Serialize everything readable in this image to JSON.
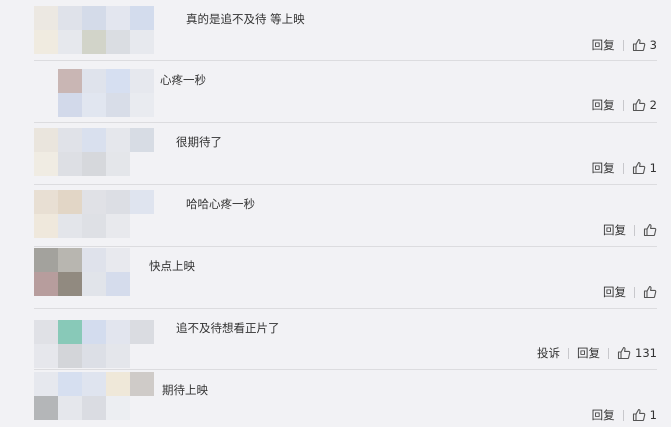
{
  "comments": [
    {
      "text": "真的是追不及待 等上映",
      "report": "",
      "reply": "回复",
      "likes": "3",
      "palette": [
        "#ece8e2",
        "#dfe2ea",
        "#d4dbe9",
        "#e3e6ef",
        "#d3dced",
        "#f0ebe0",
        "#e6e8ed",
        "#d2d4c9",
        "#dadde2",
        "#e7e9ee"
      ]
    },
    {
      "text": "心疼一秒",
      "report": "",
      "reply": "回复",
      "likes": "2",
      "palette": [
        "#c9b6b4",
        "#dfe3ec",
        "#d6dff1",
        "#e6e8ee",
        "#d2d9ea",
        "#e1e6f0",
        "#d8dde8",
        "#e9ebf0"
      ]
    },
    {
      "text": "很期待了",
      "report": "",
      "reply": "回复",
      "likes": "1",
      "palette": [
        "#eae5dd",
        "#e0e2e8",
        "#d9e0ee",
        "#e5e7ec",
        "#d7dce4",
        "#f0ece3",
        "#dddfe4",
        "#d6d8dc",
        "#e4e6ea"
      ]
    },
    {
      "text": "哈哈心疼一秒",
      "report": "",
      "reply": "回复",
      "likes": "",
      "palette": [
        "#e8dfd3",
        "#e2d6c6",
        "#e0e1e6",
        "#dcdee4",
        "#dfe4ef",
        "#efe8dc",
        "#e3e5ea",
        "#dee0e5",
        "#e8e9ed"
      ]
    },
    {
      "text": "快点上映",
      "report": "",
      "reply": "回复",
      "likes": "",
      "palette": [
        "#a3a29d",
        "#b8b6b0",
        "#dfe2eb",
        "#e8e9ee",
        "#b79d9d",
        "#918a80",
        "#e1e4ea",
        "#d5dcec"
      ]
    },
    {
      "text": "追不及待想看正片了",
      "report": "投诉",
      "reply": "回复",
      "likes": "131",
      "palette": [
        "#e0e1e6",
        "#88c9b8",
        "#d3dcee",
        "#e2e5ee",
        "#dadce1",
        "#e6e7ec",
        "#d3d5d9",
        "#dcdfe6",
        "#e4e6eb"
      ]
    },
    {
      "text": "期待上映",
      "report": "",
      "reply": "回复",
      "likes": "1",
      "palette": [
        "#e6e8ee",
        "#d6dff0",
        "#dfe4ef",
        "#efe8d9",
        "#cfcbc8",
        "#b4b6b8",
        "#e5e7ec",
        "#dadce2",
        "#eceef2"
      ]
    }
  ],
  "icons": {
    "like": "thumbs-up-icon"
  },
  "colors": {
    "background": "#f2f2f5",
    "divider": "#dcdcdf",
    "text": "#333333"
  }
}
